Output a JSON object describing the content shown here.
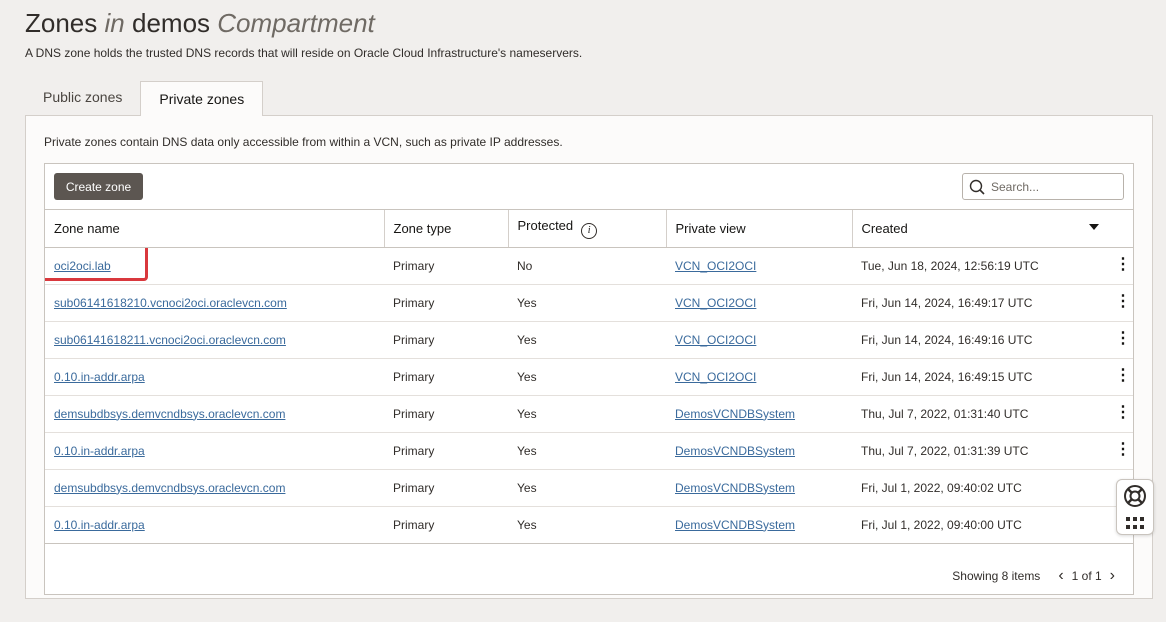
{
  "header": {
    "title_part1": "Zones",
    "title_in": "in",
    "title_compartment": "demos",
    "title_compartment_word": "Compartment",
    "description": "A DNS zone holds the trusted DNS records that will reside on Oracle Cloud Infrastructure's nameservers."
  },
  "tabs": [
    {
      "label": "Public zones",
      "active": false
    },
    {
      "label": "Private zones",
      "active": true
    }
  ],
  "panel": {
    "description": "Private zones contain DNS data only accessible from within a VCN, such as private IP addresses."
  },
  "toolbar": {
    "create_label": "Create zone",
    "search_placeholder": "Search..."
  },
  "table": {
    "columns": [
      "Zone name",
      "Zone type",
      "Protected",
      "Private view",
      "Created"
    ],
    "rows": [
      {
        "zone_name": "oci2oci.lab",
        "zone_type": "Primary",
        "protected": "No",
        "private_view": "VCN_OCI2OCI",
        "created": "Tue, Jun 18, 2024, 12:56:19 UTC"
      },
      {
        "zone_name": "sub06141618210.vcnoci2oci.oraclevcn.com",
        "zone_type": "Primary",
        "protected": "Yes",
        "private_view": "VCN_OCI2OCI",
        "created": "Fri, Jun 14, 2024, 16:49:17 UTC"
      },
      {
        "zone_name": "sub06141618211.vcnoci2oci.oraclevcn.com",
        "zone_type": "Primary",
        "protected": "Yes",
        "private_view": "VCN_OCI2OCI",
        "created": "Fri, Jun 14, 2024, 16:49:16 UTC"
      },
      {
        "zone_name": "0.10.in-addr.arpa",
        "zone_type": "Primary",
        "protected": "Yes",
        "private_view": "VCN_OCI2OCI",
        "created": "Fri, Jun 14, 2024, 16:49:15 UTC"
      },
      {
        "zone_name": "demsubdbsys.demvcndbsys.oraclevcn.com",
        "zone_type": "Primary",
        "protected": "Yes",
        "private_view": "DemosVCNDBSystem",
        "created": "Thu, Jul 7, 2022, 01:31:40 UTC"
      },
      {
        "zone_name": "0.10.in-addr.arpa",
        "zone_type": "Primary",
        "protected": "Yes",
        "private_view": "DemosVCNDBSystem",
        "created": "Thu, Jul 7, 2022, 01:31:39 UTC"
      },
      {
        "zone_name": "demsubdbsys.demvcndbsys.oraclevcn.com",
        "zone_type": "Primary",
        "protected": "Yes",
        "private_view": "DemosVCNDBSystem",
        "created": "Fri, Jul 1, 2022, 09:40:02 UTC"
      },
      {
        "zone_name": "0.10.in-addr.arpa",
        "zone_type": "Primary",
        "protected": "Yes",
        "private_view": "DemosVCNDBSystem",
        "created": "Fri, Jul 1, 2022, 09:40:00 UTC"
      }
    ]
  },
  "footer": {
    "showing": "Showing 8 items",
    "page": "1 of 1"
  },
  "colors": {
    "highlight": "#d9383d",
    "link": "#3a6a9c",
    "button": "#5c5651"
  }
}
